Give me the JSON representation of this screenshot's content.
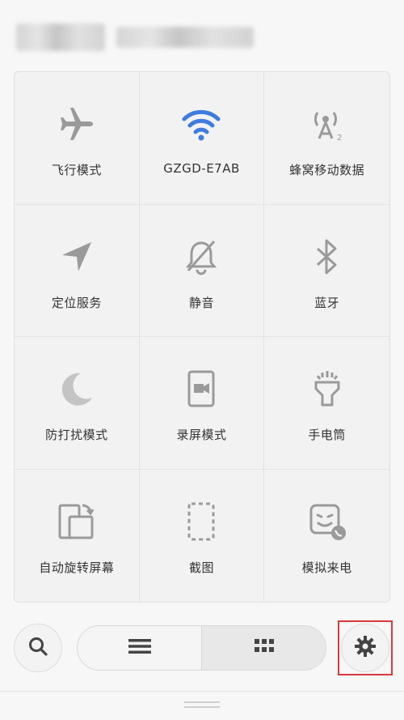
{
  "colors": {
    "accent": "#3e7ce0",
    "icon_gray": "#9a9a9a",
    "highlight": "#d93a3a"
  },
  "tiles": [
    {
      "label": "飞行模式",
      "icon": "airplane-icon"
    },
    {
      "label": "GZGD-E7AB",
      "icon": "wifi-icon"
    },
    {
      "label": "蜂窝移动数据",
      "icon": "cellular-data-icon"
    },
    {
      "label": "定位服务",
      "icon": "location-arrow-icon"
    },
    {
      "label": "静音",
      "icon": "bell-muted-icon"
    },
    {
      "label": "蓝牙",
      "icon": "bluetooth-icon"
    },
    {
      "label": "防打扰模式",
      "icon": "moon-icon"
    },
    {
      "label": "录屏模式",
      "icon": "screen-record-icon"
    },
    {
      "label": "手电筒",
      "icon": "flashlight-icon"
    },
    {
      "label": "自动旋转屏幕",
      "icon": "rotate-screen-icon"
    },
    {
      "label": "截图",
      "icon": "screenshot-icon"
    },
    {
      "label": "模拟来电",
      "icon": "fake-call-icon"
    }
  ],
  "bottom_bar": {
    "search_icon": "search-icon",
    "list_view_icon": "list-icon",
    "grid_view_icon": "grid-icon",
    "active_view": "grid",
    "settings_icon": "gear-icon"
  }
}
